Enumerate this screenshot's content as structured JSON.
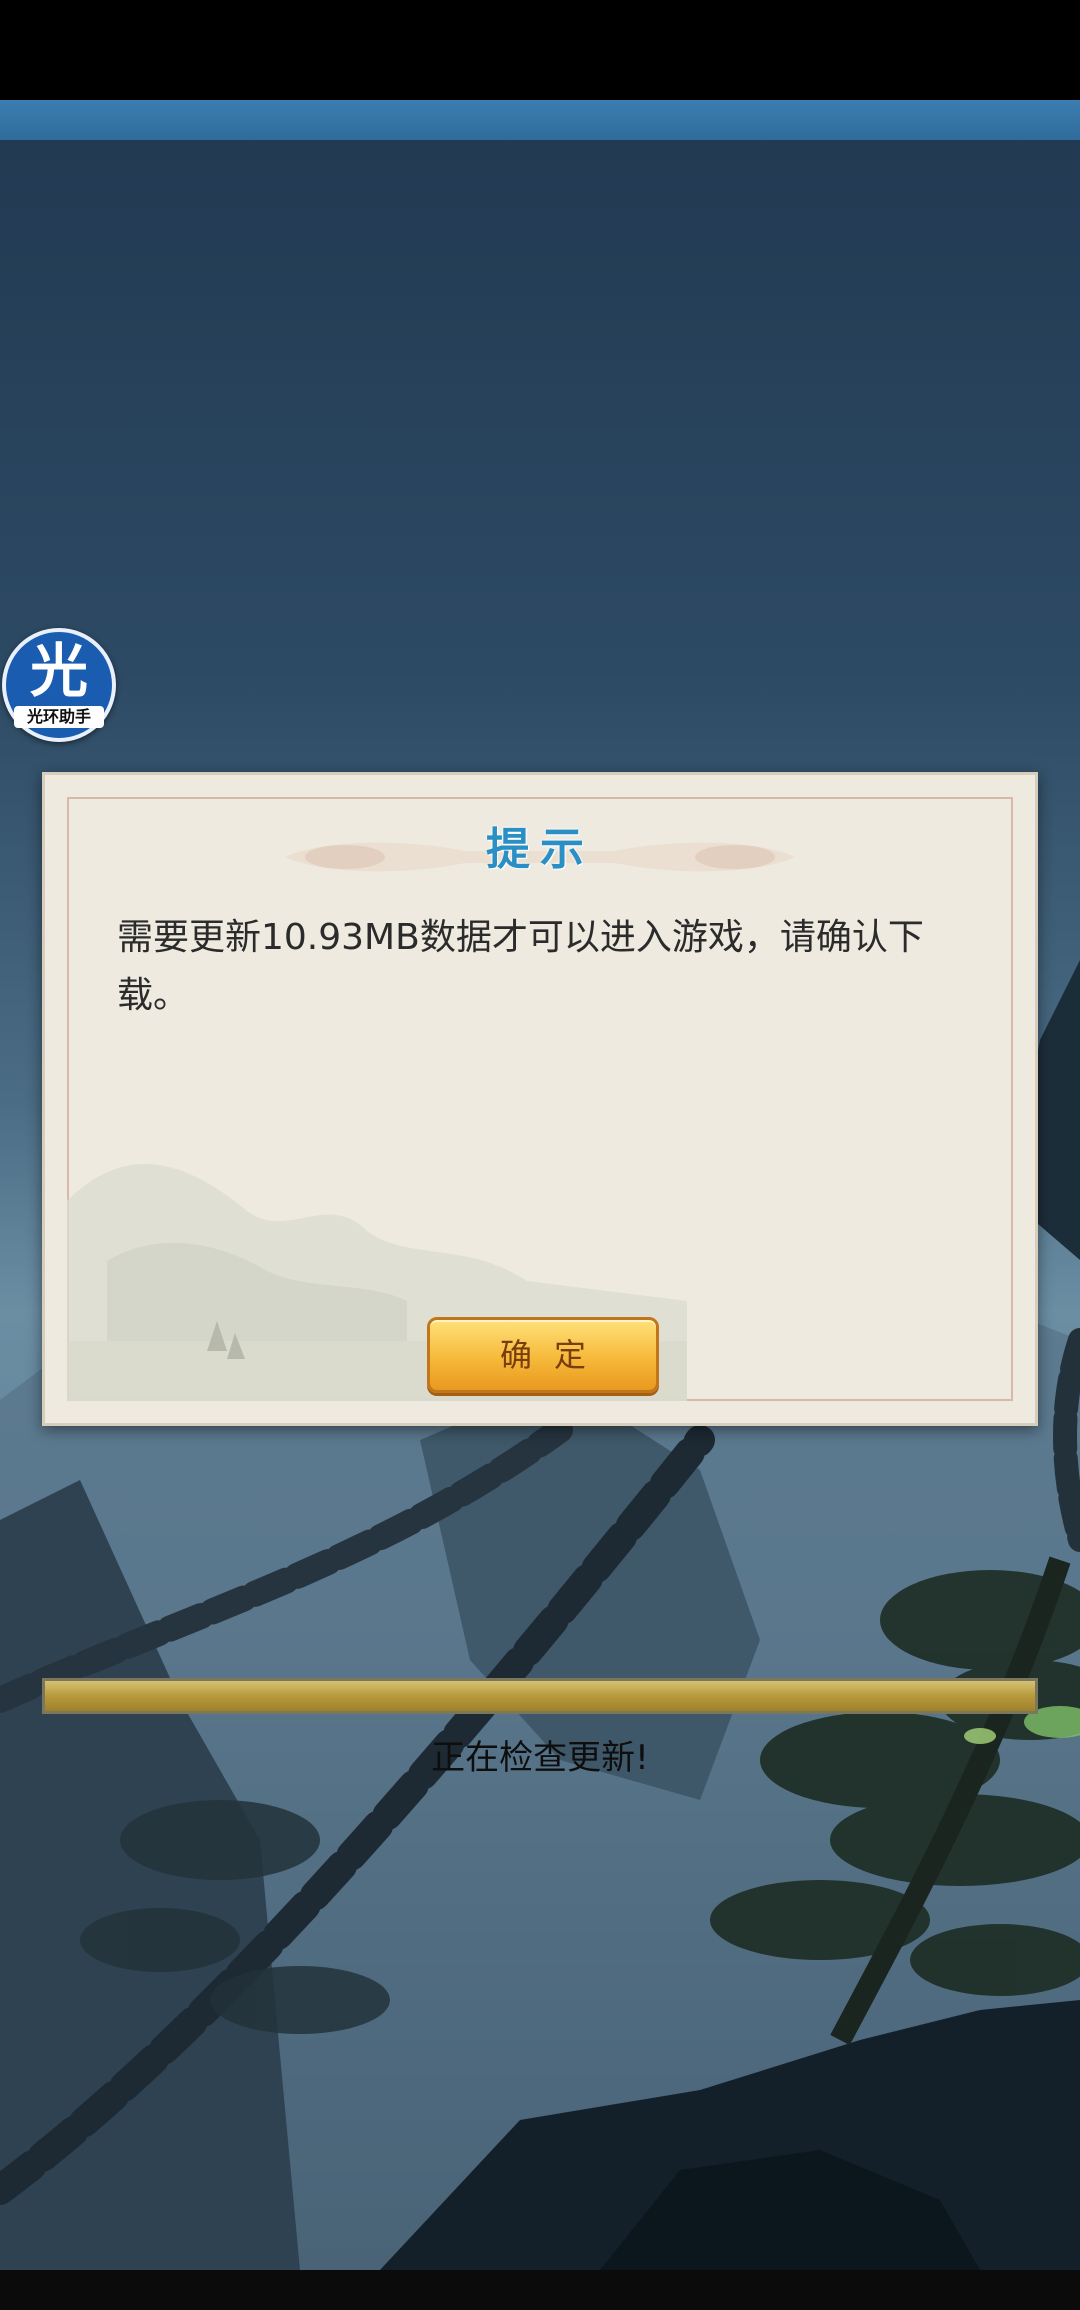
{
  "assistant_float": {
    "glyph": "光",
    "label": "光环助手"
  },
  "dialog": {
    "title": "提示",
    "message": "需要更新10.93MB数据才可以进入游戏，请确认下载。",
    "confirm_label": "确定"
  },
  "loading": {
    "progress": 1.0,
    "status_text": "正在检查更新!"
  },
  "colors": {
    "title_blue": "#2a8fc4",
    "button_gold": "#f6b93a",
    "dialog_paper": "#eeeae0"
  }
}
